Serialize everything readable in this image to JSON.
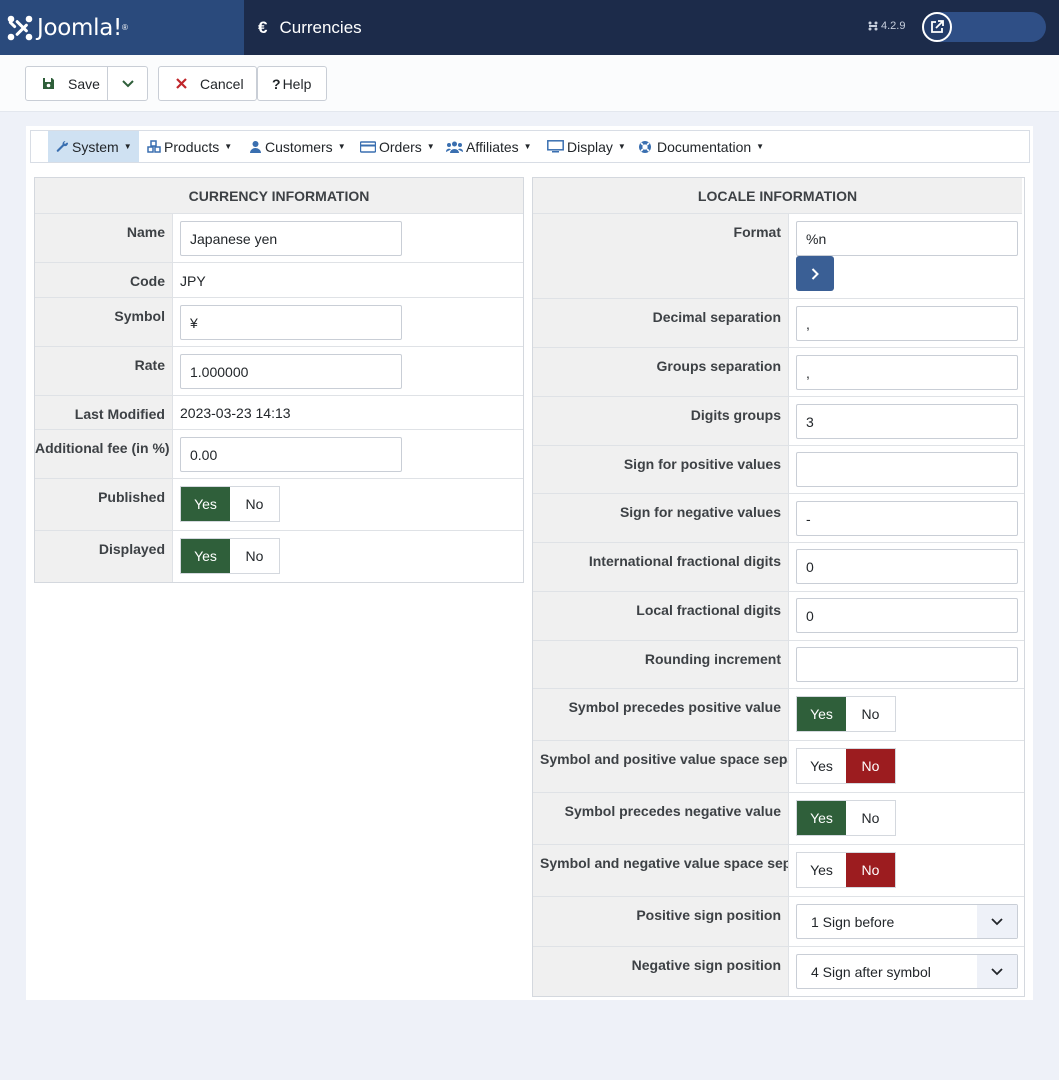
{
  "header": {
    "logo_text": "Joomla!",
    "logo_tm": "®",
    "page_icon": "€",
    "page_title": "Currencies",
    "version": "4.2.9"
  },
  "toolbar": {
    "save_label": "Save",
    "cancel_label": "Cancel",
    "help_label": "Help"
  },
  "menu": {
    "items": [
      {
        "label": "System"
      },
      {
        "label": "Products"
      },
      {
        "label": "Customers"
      },
      {
        "label": "Orders"
      },
      {
        "label": "Affiliates"
      },
      {
        "label": "Display"
      },
      {
        "label": "Documentation"
      }
    ],
    "dropdown_caret": "▼"
  },
  "currency": {
    "heading": "CURRENCY INFORMATION",
    "name_label": "Name",
    "name_value": "Japanese yen",
    "code_label": "Code",
    "code_value": "JPY",
    "symbol_label": "Symbol",
    "symbol_value": "¥",
    "rate_label": "Rate",
    "rate_value": "1.000000",
    "modified_label": "Last Modified",
    "modified_value": "2023-03-23 14:13",
    "fee_label": "Additional fee (in %)",
    "fee_value": "0.00",
    "published_label": "Published",
    "displayed_label": "Displayed"
  },
  "toggle": {
    "yes": "Yes",
    "no": "No"
  },
  "locale": {
    "heading": "LOCALE INFORMATION",
    "format_label": "Format",
    "format_value": "%n",
    "decimal_label": "Decimal separation",
    "decimal_value": ",",
    "groups_label": "Groups separation",
    "groups_value": ",",
    "digits_label": "Digits groups",
    "digits_value": "3",
    "pos_sign_label": "Sign for positive values",
    "pos_sign_value": "",
    "neg_sign_label": "Sign for negative values",
    "neg_sign_value": "-",
    "intl_frac_label": "International fractional digits",
    "intl_frac_value": "0",
    "local_frac_label": "Local fractional digits",
    "local_frac_value": "0",
    "rounding_label": "Rounding increment",
    "rounding_value": "",
    "sym_pre_pos_label": "Symbol precedes positive value",
    "sym_sp_pos_label": "Symbol and positive value space separation",
    "sym_pre_neg_label": "Symbol precedes negative value",
    "sym_sp_neg_label": "Symbol and negative value space separation",
    "pos_pos_label": "Positive sign position",
    "pos_pos_value": "1 Sign before",
    "neg_pos_label": "Negative sign position",
    "neg_pos_value": "4 Sign after symbol"
  },
  "colors": {
    "header_bg": "#1c2b4a",
    "logo_bg": "#2a4a7c",
    "yes_active": "#2f5f3a",
    "no_active": "#9c1c1f",
    "menu_active": "#cfe1f2"
  }
}
